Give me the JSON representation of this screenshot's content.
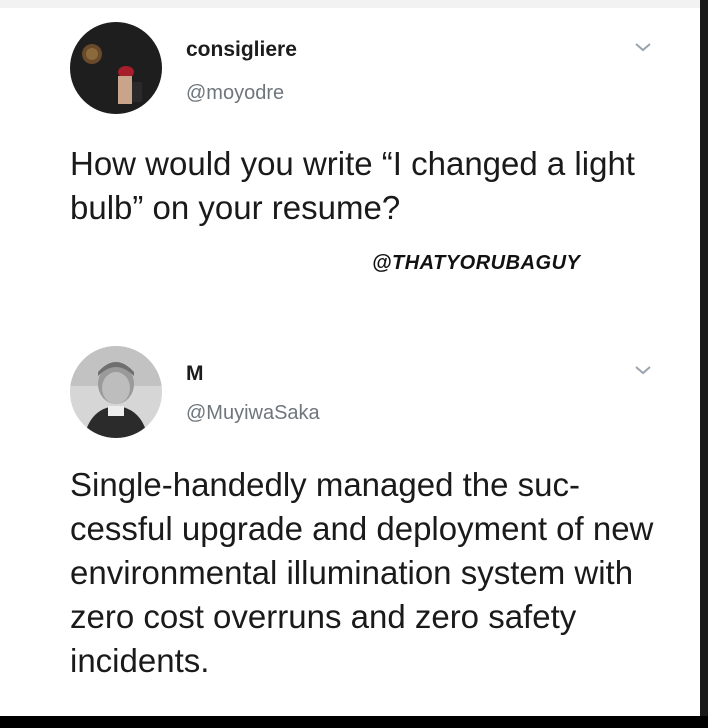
{
  "tweet1": {
    "name": "consigliere",
    "handle": "@moyodre",
    "text": "How would you write “I changed a light bulb” on your resume?",
    "avatar_icon": "profile-photo-dark"
  },
  "watermark": "@THATYORUBAGUY",
  "tweet2": {
    "name": "M",
    "handle": "@MuyiwaSaka",
    "text": "Single-handedly managed the suc-cessful upgrade and deployment of new environmental illumination system with zero cost overruns and zero safety incidents.",
    "avatar_icon": "profile-photo-grayscale-portrait"
  },
  "colors": {
    "text": "#1a1a1a",
    "handle": "#6e767d",
    "chevron": "#9aa4ad",
    "background": "#ffffff",
    "bottom_bar": "#000000"
  }
}
